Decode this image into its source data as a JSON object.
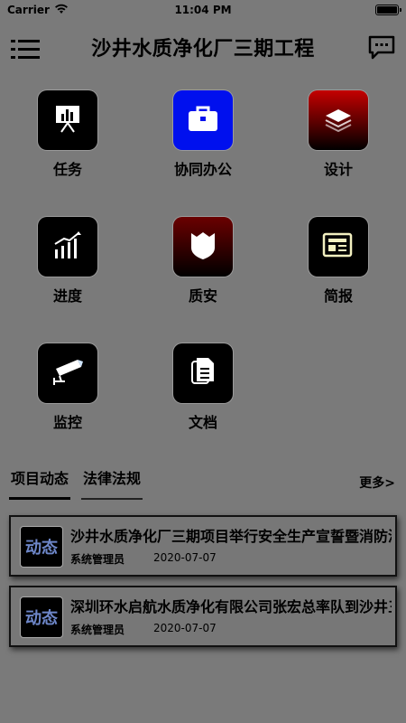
{
  "status_bar": {
    "carrier": "Carrier",
    "time": "11:04 PM"
  },
  "nav": {
    "title": "沙井水质净化厂三期工程"
  },
  "grid": {
    "items": [
      {
        "label": "任务",
        "icon": "presentation-chart-icon"
      },
      {
        "label": "协同办公",
        "icon": "briefcase-icon"
      },
      {
        "label": "设计",
        "icon": "layers-icon"
      },
      {
        "label": "进度",
        "icon": "bar-chart-trend-icon"
      },
      {
        "label": "质安",
        "icon": "shield-icon"
      },
      {
        "label": "简报",
        "icon": "newspaper-icon"
      },
      {
        "label": "监控",
        "icon": "security-camera-icon"
      },
      {
        "label": "文档",
        "icon": "documents-icon"
      }
    ]
  },
  "tabs": {
    "items": [
      {
        "label": "项目动态",
        "active": true
      },
      {
        "label": "法律法规",
        "active": false
      }
    ],
    "more_label": "更多>"
  },
  "news": {
    "items": [
      {
        "thumb": "动态",
        "title": "沙井水质净化厂三期项目举行安全生产宣誓暨消防演练活动",
        "author": "系统管理员",
        "date": "2020-07-07"
      },
      {
        "thumb": "动态",
        "title": "深圳环水启航水质净化有限公司张宏总率队到沙井三期项目检查",
        "author": "系统管理员",
        "date": "2020-07-07"
      }
    ]
  }
}
